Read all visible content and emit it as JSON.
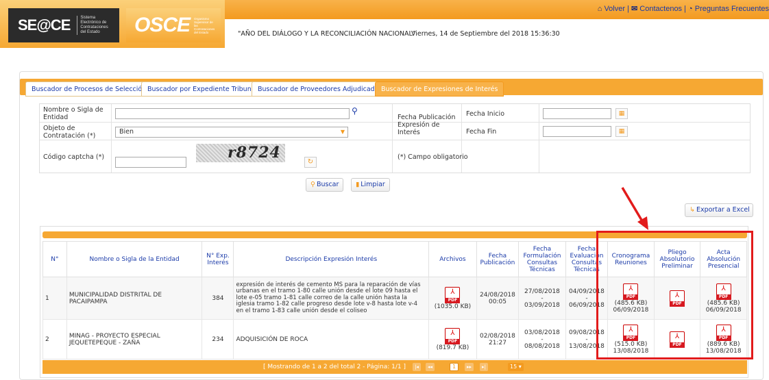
{
  "header": {
    "seace_logo": "SE@CE",
    "seace_sub": "Sistema Electrónico de Contrataciones del Estado",
    "osce_logo": "OSCE",
    "osce_sub": "Organismo Supervisor de las Contrataciones del Estado",
    "year_text": "\"AÑO DEL DIÁLOGO Y LA RECONCILIACIÓN NACIONAL\"",
    "date_text": "Viernes, 14 de Septiembre del 2018 15:36:30",
    "links": {
      "volver": "Volver",
      "sep1": "|",
      "contactenos": "Contactenos",
      "sep2": "|",
      "preguntas": "Preguntas Frecuentes"
    }
  },
  "tabs": [
    {
      "label": "Buscador de Procesos de Selección"
    },
    {
      "label": "Buscador por Expediente Tribunal"
    },
    {
      "label": "Buscador de Proveedores Adjudicados"
    },
    {
      "label": "Buscador de Expresiones de Interés"
    }
  ],
  "form": {
    "entidad_label": "Nombre o Sigla de Entidad",
    "entidad_value": "",
    "objeto_label": "Objeto de Contratación (*)",
    "objeto_value": "Bien",
    "captcha_label": "Código captcha (*)",
    "captcha_text": "r8724",
    "captcha_value": "",
    "fecha_pub_label": "Fecha Publicación Expresión de Interés",
    "fecha_inicio_label": "Fecha Inicio",
    "fecha_inicio_value": "",
    "fecha_fin_label": "Fecha Fin",
    "fecha_fin_value": "",
    "obligatorio_note": "(*) Campo obligatorio",
    "buscar_label": "Buscar",
    "limpiar_label": "Limpiar"
  },
  "export_label": "Exportar a Excel",
  "table": {
    "headers": {
      "n": "N°",
      "entidad": "Nombre o Sigla de la Entidad",
      "exp": "N° Exp. Interés",
      "descripcion": "Descripción Expresión Interés",
      "archivos": "Archivos",
      "fecha_pub": "Fecha Publicación",
      "fecha_form": "Fecha Formulación Consultas Técnicas",
      "fecha_eval": "Fecha Evaluación Consultas Técnicas",
      "cronograma": "Cronograma Reuniones",
      "pliego": "Pliego Absolutorio Preliminar",
      "acta": "Acta Absolución Presencial"
    },
    "rows": [
      {
        "n": "1",
        "entidad": "MUNICIPALIDAD DISTRITAL DE PACAIPAMPA",
        "exp": "384",
        "descripcion": "expresión de interés de cemento MS para la reparación de vías urbanas en el tramo 1-80 calle unión desde el lote 09 hasta el lote e-05 tramo 1-81 calle correo de la calle unión hasta la iglesia tramo 1-82 calle progreso desde lote v-8 hasta lote v-4 en el tramo 1-83 calle unión desde el coliseo",
        "archivo_size": "(1035.0 KB)",
        "fecha_pub": "24/08/2018 00:05",
        "fecha_form_1": "27/08/2018",
        "fecha_form_sep": "-",
        "fecha_form_2": "03/09/2018",
        "fecha_eval_1": "04/09/2018",
        "fecha_eval_sep": "-",
        "fecha_eval_2": "06/09/2018",
        "cronograma_size": "(485.6 KB)",
        "cronograma_date": "06/09/2018",
        "acta_size": "(485.6 KB)",
        "acta_date": "06/09/2018"
      },
      {
        "n": "2",
        "entidad": "MINAG - PROYECTO ESPECIAL JEQUETEPEQUE - ZAÑA",
        "exp": "234",
        "descripcion": "ADQUISICIÓN DE ROCA",
        "archivo_size": "(819.7 KB)",
        "fecha_pub": "02/08/2018 21:27",
        "fecha_form_1": "03/08/2018",
        "fecha_form_sep": "-",
        "fecha_form_2": "08/08/2018",
        "fecha_eval_1": "09/08/2018",
        "fecha_eval_sep": "-",
        "fecha_eval_2": "13/08/2018",
        "cronograma_size": "(515.0 KB)",
        "cronograma_date": "13/08/2018",
        "acta_size": "(889.6 KB)",
        "acta_date": "13/08/2018"
      }
    ],
    "pdf_tag": "PDF"
  },
  "pager": {
    "text": "[ Mostrando de 1 a 2 del total 2 - Página: 1/1 ]",
    "current_page": "1",
    "page_size": "15 ▾"
  },
  "colors": {
    "accent": "#f6a833",
    "link": "#1a3aa8",
    "highlight": "#e21b1b"
  }
}
